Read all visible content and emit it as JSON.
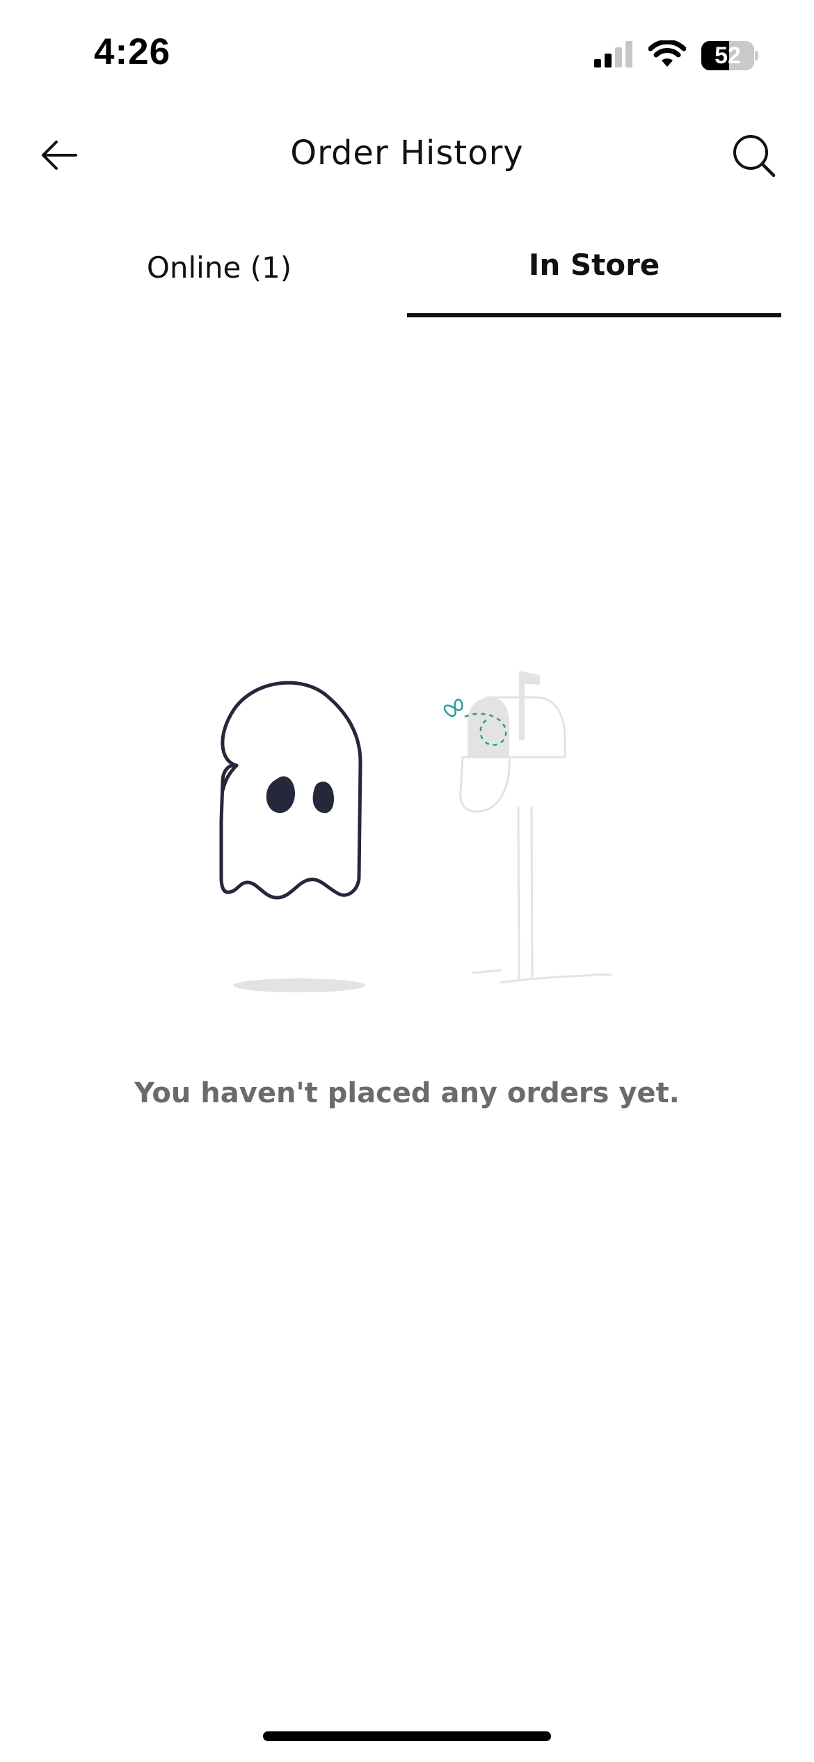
{
  "status_bar": {
    "time": "4:26",
    "battery_level": "52",
    "battery_fraction": 0.52,
    "icons": [
      "cellular-signal-icon",
      "wifi-icon",
      "battery-icon"
    ]
  },
  "header": {
    "title": "Order History",
    "back_icon": "arrow-left-icon",
    "search_icon": "search-icon"
  },
  "tabs": [
    {
      "label": "Online (1)",
      "selected": false
    },
    {
      "label": "In Store",
      "selected": true
    }
  ],
  "empty_state": {
    "illustration": "ghost-mailbox-illustration",
    "message": "You haven't placed any orders yet."
  },
  "colors": {
    "accent_tab_indicator": "#111111",
    "empty_text": "#6b6b6b",
    "ghost_outline": "#25283a",
    "illustration_gray": "#e3e3e3",
    "butterfly_teal": "#2a9d9b"
  }
}
